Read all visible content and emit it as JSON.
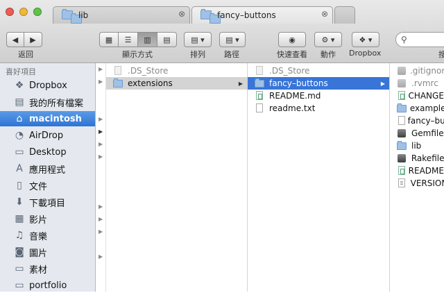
{
  "tabs": [
    {
      "label": "lib",
      "close": "⊗"
    },
    {
      "label": "fancy–buttons",
      "close": "⊗"
    }
  ],
  "toolbar": {
    "back_label": "返回",
    "view_label": "顯示方式",
    "arrange_label": "排列",
    "path_label": "路徑",
    "quicklook_label": "快速查看",
    "action_label": "動作",
    "dropbox_label": "Dropbox",
    "search_label": "搜"
  },
  "sidebar": {
    "heading": "喜好項目",
    "items": [
      {
        "label": "Dropbox",
        "icon": "dropbox-icon"
      },
      {
        "label": "我的所有檔案",
        "icon": "all-files-icon"
      },
      {
        "label": "macintosh",
        "icon": "home-icon"
      },
      {
        "label": "AirDrop",
        "icon": "airdrop-icon"
      },
      {
        "label": "Desktop",
        "icon": "desktop-icon"
      },
      {
        "label": "應用程式",
        "icon": "applications-icon"
      },
      {
        "label": "文件",
        "icon": "documents-icon"
      },
      {
        "label": "下載項目",
        "icon": "downloads-icon"
      },
      {
        "label": "影片",
        "icon": "movies-icon"
      },
      {
        "label": "音樂",
        "icon": "music-icon"
      },
      {
        "label": "圖片",
        "icon": "pictures-icon"
      },
      {
        "label": "素材",
        "icon": "folder-icon"
      },
      {
        "label": "portfolio",
        "icon": "folder-icon"
      }
    ]
  },
  "columns": {
    "col1": [
      {
        "name": ".DS_Store",
        "kind": "doc-gray",
        "state": "dim"
      },
      {
        "name": "extensions",
        "kind": "folder",
        "state": "gray",
        "arrow": "▶"
      }
    ],
    "col2": [
      {
        "name": ".DS_Store",
        "kind": "doc-gray",
        "state": "dim"
      },
      {
        "name": "fancy–buttons",
        "kind": "folder",
        "state": "blue",
        "arrow": "▶"
      },
      {
        "name": "README.md",
        "kind": "doc-green",
        "state": ""
      },
      {
        "name": "readme.txt",
        "kind": "doc",
        "state": ""
      }
    ],
    "col3": [
      {
        "name": ".gitignore",
        "kind": "black-dim",
        "state": "dim"
      },
      {
        "name": ".rvmrc",
        "kind": "black-dim",
        "state": "dim"
      },
      {
        "name": "CHANGELOG",
        "kind": "doc-green",
        "state": ""
      },
      {
        "name": "examples",
        "kind": "folder",
        "state": ""
      },
      {
        "name": "fancy–buttons",
        "kind": "doc",
        "state": ""
      },
      {
        "name": "Gemfile",
        "kind": "black",
        "state": ""
      },
      {
        "name": "lib",
        "kind": "folder",
        "state": ""
      },
      {
        "name": "Rakefile",
        "kind": "black",
        "state": ""
      },
      {
        "name": "README.md",
        "kind": "doc-green",
        "state": ""
      },
      {
        "name": "VERSION",
        "kind": "doc-lines",
        "state": ""
      }
    ]
  }
}
